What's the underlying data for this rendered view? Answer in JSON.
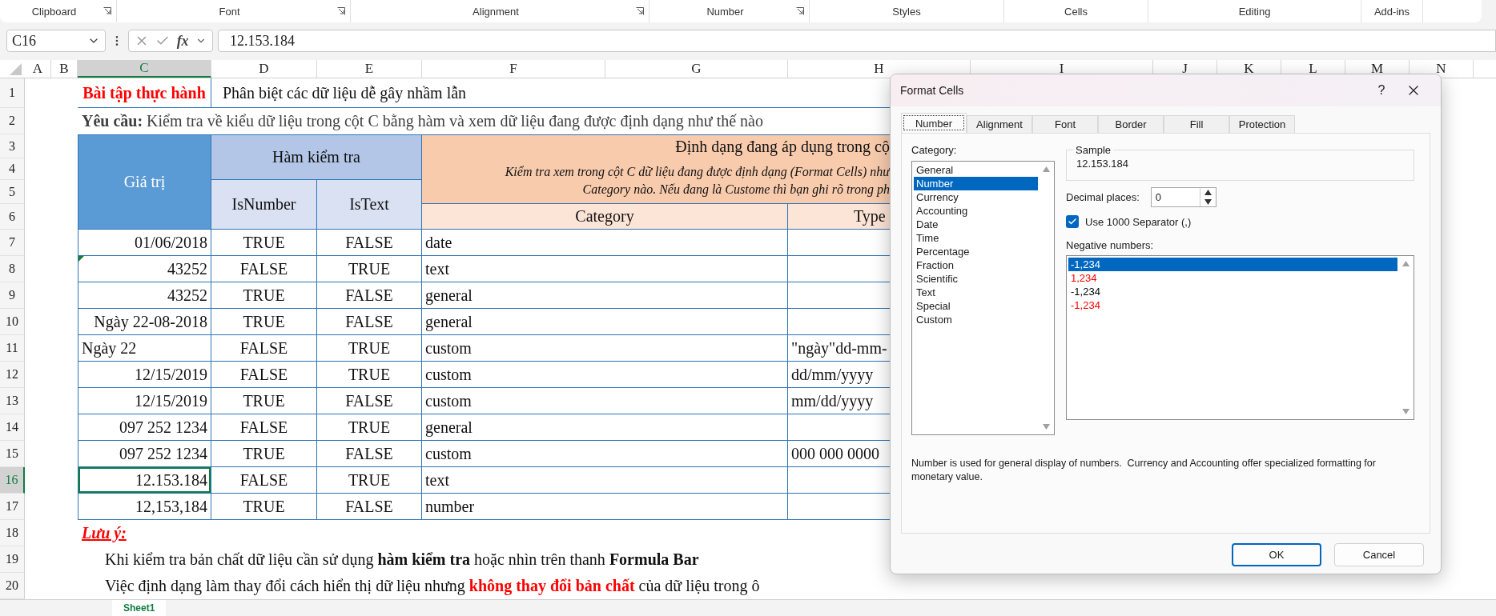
{
  "ribbon": {
    "groups": [
      {
        "label": "Clipboard",
        "launcher": true
      },
      {
        "label": "Font",
        "launcher": true
      },
      {
        "label": "Alignment",
        "launcher": true
      },
      {
        "label": "Number",
        "launcher": true
      },
      {
        "label": "Styles",
        "launcher": false
      },
      {
        "label": "Cells",
        "launcher": false
      },
      {
        "label": "Editing",
        "launcher": false
      },
      {
        "label": "Add-ins",
        "launcher": false
      }
    ]
  },
  "formula_bar": {
    "name_box": "C16",
    "function_label": "fx",
    "formula": "12.153.184"
  },
  "column_headers": [
    {
      "label": "A",
      "selected": false
    },
    {
      "label": "B",
      "selected": false
    },
    {
      "label": "C",
      "selected": true
    },
    {
      "label": "D",
      "selected": false
    },
    {
      "label": "E",
      "selected": false
    },
    {
      "label": "F",
      "selected": false
    },
    {
      "label": "G",
      "selected": false
    },
    {
      "label": "H",
      "selected": false
    },
    {
      "label": "I",
      "selected": false
    },
    {
      "label": "J",
      "selected": false
    },
    {
      "label": "K",
      "selected": false
    },
    {
      "label": "L",
      "selected": false
    },
    {
      "label": "M",
      "selected": false
    },
    {
      "label": "N",
      "selected": false
    }
  ],
  "row_headers": [
    {
      "label": "1",
      "selected": false
    },
    {
      "label": "2",
      "selected": false
    },
    {
      "label": "3",
      "selected": false
    },
    {
      "label": "4",
      "selected": false
    },
    {
      "label": "5",
      "selected": false
    },
    {
      "label": "6",
      "selected": false
    },
    {
      "label": "7",
      "selected": false
    },
    {
      "label": "8",
      "selected": false
    },
    {
      "label": "9",
      "selected": false
    },
    {
      "label": "10",
      "selected": false
    },
    {
      "label": "11",
      "selected": false
    },
    {
      "label": "12",
      "selected": false
    },
    {
      "label": "13",
      "selected": false
    },
    {
      "label": "14",
      "selected": false
    },
    {
      "label": "15",
      "selected": false
    },
    {
      "label": "16",
      "selected": true
    },
    {
      "label": "17",
      "selected": false
    },
    {
      "label": "18",
      "selected": false
    },
    {
      "label": "19",
      "selected": false
    },
    {
      "label": "20",
      "selected": false
    }
  ],
  "sheet": {
    "title": "Bài tập thực hành",
    "subtitle": "Phân biệt các dữ liệu dễ gây nhầm lẫn",
    "requirement": "**Yêu cầu:** Kiểm tra về kiểu dữ liệu trong cột C bằng hàm và xem dữ liệu đang được định dạng như thế nào",
    "table": {
      "header_value": "Giá trị",
      "header_functions": "Hàm kiểm tra",
      "header_isnumber": "IsNumber",
      "header_istext": "IsText",
      "header_format": "Định dạng đang áp dụng trong cộ",
      "format_note_1": "Kiểm tra xem trong cột C dữ liệu đang được định dạng (Format Cells) như",
      "format_note_2": "Category nào. Nếu đang là Custome thì bạn ghi rõ trong ph",
      "header_category": "Category",
      "header_type": "Type"
    },
    "rows": [
      {
        "value": "01/06/2018",
        "left_aligned": false,
        "error_flag": false,
        "selected": false,
        "is_number": "TRUE",
        "is_text": "FALSE",
        "category": "date"
      },
      {
        "value": "43252",
        "left_aligned": false,
        "error_flag": true,
        "selected": false,
        "is_number": "FALSE",
        "is_text": "TRUE",
        "category": "text"
      },
      {
        "value": "43252",
        "left_aligned": false,
        "error_flag": false,
        "selected": false,
        "is_number": "TRUE",
        "is_text": "FALSE",
        "category": "general"
      },
      {
        "value": "Ngày 22-08-2018",
        "left_aligned": false,
        "error_flag": false,
        "selected": false,
        "is_number": "TRUE",
        "is_text": "FALSE",
        "category": "general"
      },
      {
        "value": "Ngày 22",
        "left_aligned": true,
        "error_flag": false,
        "selected": false,
        "is_number": "FALSE",
        "is_text": "TRUE",
        "category": "custom",
        "type": "\"ngày\"dd-mm-"
      },
      {
        "value": "12/15/2019",
        "left_aligned": false,
        "error_flag": false,
        "selected": false,
        "is_number": "FALSE",
        "is_text": "TRUE",
        "category": "custom",
        "type": "dd/mm/yyyy"
      },
      {
        "value": "12/15/2019",
        "left_aligned": false,
        "error_flag": false,
        "selected": false,
        "is_number": "TRUE",
        "is_text": "FALSE",
        "category": "custom",
        "type": "mm/dd/yyyy"
      },
      {
        "value": "097 252 1234",
        "left_aligned": false,
        "error_flag": false,
        "selected": false,
        "is_number": "FALSE",
        "is_text": "TRUE",
        "category": "general"
      },
      {
        "value": "097 252 1234",
        "left_aligned": false,
        "error_flag": false,
        "selected": false,
        "is_number": "TRUE",
        "is_text": "FALSE",
        "category": "custom",
        "type": "000 000 0000"
      },
      {
        "value": "12.153.184",
        "left_aligned": false,
        "error_flag": false,
        "selected": true,
        "is_number": "FALSE",
        "is_text": "TRUE",
        "category": "text"
      },
      {
        "value": "12,153,184",
        "left_aligned": false,
        "error_flag": false,
        "selected": false,
        "is_number": "TRUE",
        "is_text": "FALSE",
        "category": "number"
      }
    ],
    "note_title": "Lưu ý:",
    "note_1": "Khi kiểm tra bản chất dữ liệu cần sử dụng **hàm kiểm tra** hoặc nhìn trên thanh **Formula Bar**",
    "note_2": "Việc định dạng làm thay đổi cách hiển thị dữ liệu nhưng **không thay đổi bản chất** của dữ liệu trong ô"
  },
  "dialog": {
    "title": "Format Cells",
    "help": "?",
    "tabs": [
      {
        "label": "Number",
        "selected": true
      },
      {
        "label": "Alignment",
        "selected": false
      },
      {
        "label": "Font",
        "selected": false
      },
      {
        "label": "Border",
        "selected": false
      },
      {
        "label": "Fill",
        "selected": false
      },
      {
        "label": "Protection",
        "selected": false
      }
    ],
    "category_label": "Category:",
    "categories": [
      {
        "label": "General",
        "selected": false
      },
      {
        "label": "Number",
        "selected": true
      },
      {
        "label": "Currency",
        "selected": false
      },
      {
        "label": "Accounting",
        "selected": false
      },
      {
        "label": "Date",
        "selected": false
      },
      {
        "label": "Time",
        "selected": false
      },
      {
        "label": "Percentage",
        "selected": false
      },
      {
        "label": "Fraction",
        "selected": false
      },
      {
        "label": "Scientific",
        "selected": false
      },
      {
        "label": "Text",
        "selected": false
      },
      {
        "label": "Special",
        "selected": false
      },
      {
        "label": "Custom",
        "selected": false
      }
    ],
    "sample_label": "Sample",
    "sample": "12.153.184",
    "decimal_label": "Decimal places:",
    "decimal_value": "0",
    "separator": {
      "label": "Use 1000 Separator (,)",
      "checked": true
    },
    "negative_label": "Negative numbers:",
    "negatives": [
      {
        "label": "-1,234",
        "selected": true
      },
      {
        "label": "1,234",
        "selected": false,
        "color": "#ff0000"
      },
      {
        "label": "-1,234",
        "selected": false,
        "color": "#000000"
      },
      {
        "label": "-1,234",
        "selected": false,
        "color": "#ff0000"
      }
    ],
    "description": "Number is used for general display of numbers.  Currency and Accounting offer specialized formatting for monetary value.",
    "buttons": [
      {
        "label": "OK",
        "default": true
      },
      {
        "label": "Cancel",
        "default": false
      }
    ]
  },
  "sheet_tabs": [
    {
      "label": "Sheet1",
      "selected": true
    }
  ]
}
